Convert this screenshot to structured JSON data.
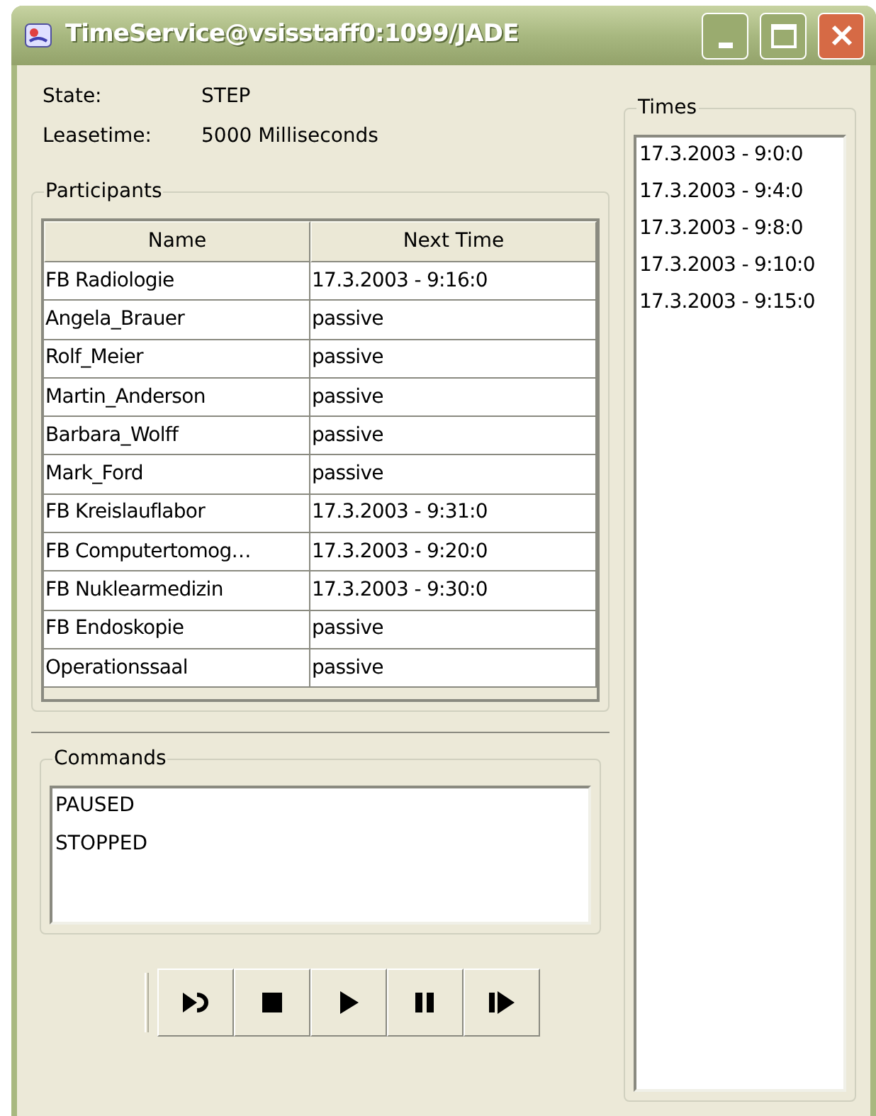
{
  "window": {
    "title": "TimeService@vsisstaff0:1099/JADE"
  },
  "info": [
    {
      "label": "State:",
      "value": "STEP"
    },
    {
      "label": "Leasetime:",
      "value": "5000 Milliseconds"
    }
  ],
  "participants": {
    "title": "Participants",
    "columns": [
      "Name",
      "Next Time"
    ],
    "rows": [
      [
        "FB Radiologie",
        "17.3.2003 - 9:16:0"
      ],
      [
        "Angela_Brauer",
        "passive"
      ],
      [
        "Rolf_Meier",
        "passive"
      ],
      [
        "Martin_Anderson",
        "passive"
      ],
      [
        "Barbara_Wolff",
        "passive"
      ],
      [
        "Mark_Ford",
        "passive"
      ],
      [
        "FB Kreislauflabor",
        "17.3.2003 - 9:31:0"
      ],
      [
        "FB Computertomog…",
        "17.3.2003 - 9:20:0"
      ],
      [
        "FB Nuklearmedizin",
        "17.3.2003 - 9:30:0"
      ],
      [
        "FB Endoskopie",
        "passive"
      ],
      [
        "Operationssaal",
        "passive"
      ]
    ]
  },
  "commands": {
    "title": "Commands",
    "items": [
      "PAUSED",
      "STOPPED"
    ]
  },
  "toolbar": [
    {
      "kind": "step"
    },
    {
      "kind": "stop"
    },
    {
      "kind": "play"
    },
    {
      "kind": "pause"
    },
    {
      "kind": "step-forward"
    }
  ],
  "times": {
    "title": "Times",
    "items": [
      "17.3.2003 - 9:0:0",
      "17.3.2003 - 9:4:0",
      "17.3.2003 - 9:8:0",
      "17.3.2003 - 9:10:0",
      "17.3.2003 - 9:15:0"
    ]
  }
}
